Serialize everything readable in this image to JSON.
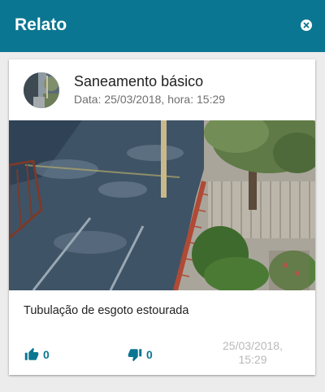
{
  "header": {
    "title": "Relato",
    "close_icon": "close-circle-icon",
    "background": "#0b7691"
  },
  "post": {
    "title": "Saneamento básico",
    "date_line": "Data: 25/03/2018, hora: 15:29",
    "description": "Tubulação de esgoto estourada",
    "likes": "0",
    "dislikes": "0",
    "footer_date": "25/03/2018,",
    "footer_time": "15:29",
    "like_icon": "thumb-up-icon",
    "dislike_icon": "thumb-down-icon",
    "accent": "#0b7691"
  }
}
